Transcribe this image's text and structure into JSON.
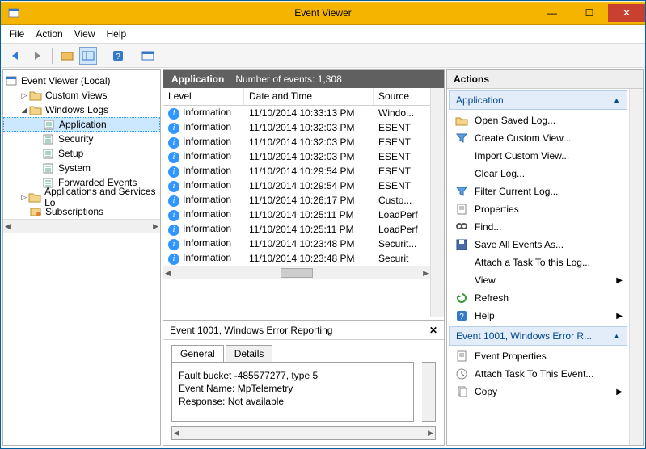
{
  "window": {
    "title": "Event Viewer"
  },
  "menu": [
    "File",
    "Action",
    "View",
    "Help"
  ],
  "nav": {
    "root": "Event Viewer (Local)",
    "items": [
      {
        "label": "Custom Views",
        "indent": 1,
        "tw": "▷",
        "icon": "folder"
      },
      {
        "label": "Windows Logs",
        "indent": 1,
        "tw": "◢",
        "icon": "folder"
      },
      {
        "label": "Application",
        "indent": 2,
        "sel": true,
        "icon": "log"
      },
      {
        "label": "Security",
        "indent": 2,
        "icon": "log"
      },
      {
        "label": "Setup",
        "indent": 2,
        "icon": "log"
      },
      {
        "label": "System",
        "indent": 2,
        "icon": "log"
      },
      {
        "label": "Forwarded Events",
        "indent": 2,
        "icon": "log"
      },
      {
        "label": "Applications and Services Lo",
        "indent": 1,
        "tw": "▷",
        "icon": "folder"
      },
      {
        "label": "Subscriptions",
        "indent": 1,
        "icon": "sub"
      }
    ]
  },
  "center": {
    "title": "Application",
    "count_label": "Number of events: 1,308",
    "cols": [
      "Level",
      "Date and Time",
      "Source"
    ],
    "rows": [
      {
        "level": "Information",
        "dt": "11/10/2014 10:33:13 PM",
        "src": "Windo..."
      },
      {
        "level": "Information",
        "dt": "11/10/2014 10:32:03 PM",
        "src": "ESENT"
      },
      {
        "level": "Information",
        "dt": "11/10/2014 10:32:03 PM",
        "src": "ESENT"
      },
      {
        "level": "Information",
        "dt": "11/10/2014 10:32:03 PM",
        "src": "ESENT"
      },
      {
        "level": "Information",
        "dt": "11/10/2014 10:29:54 PM",
        "src": "ESENT"
      },
      {
        "level": "Information",
        "dt": "11/10/2014 10:29:54 PM",
        "src": "ESENT"
      },
      {
        "level": "Information",
        "dt": "11/10/2014 10:26:17 PM",
        "src": "Custo..."
      },
      {
        "level": "Information",
        "dt": "11/10/2014 10:25:11 PM",
        "src": "LoadPerf"
      },
      {
        "level": "Information",
        "dt": "11/10/2014 10:25:11 PM",
        "src": "LoadPerf"
      },
      {
        "level": "Information",
        "dt": "11/10/2014 10:23:48 PM",
        "src": "Securit..."
      },
      {
        "level": "Information",
        "dt": "11/10/2014 10:23:48 PM",
        "src": "Securit"
      }
    ]
  },
  "detail": {
    "title": "Event 1001, Windows Error Reporting",
    "tabs": [
      "General",
      "Details"
    ],
    "lines": [
      "Fault bucket -485577277, type 5",
      "Event Name: MpTelemetry",
      "Response: Not available"
    ]
  },
  "actions": {
    "title": "Actions",
    "section1": "Application",
    "items1": [
      {
        "label": "Open Saved Log...",
        "icon": "open"
      },
      {
        "label": "Create Custom View...",
        "icon": "filter"
      },
      {
        "label": "Import Custom View...",
        "icon": ""
      },
      {
        "label": "Clear Log...",
        "icon": ""
      },
      {
        "label": "Filter Current Log...",
        "icon": "filter"
      },
      {
        "label": "Properties",
        "icon": "props"
      },
      {
        "label": "Find...",
        "icon": "find"
      },
      {
        "label": "Save All Events As...",
        "icon": "save"
      },
      {
        "label": "Attach a Task To this Log...",
        "icon": ""
      },
      {
        "label": "View",
        "icon": "",
        "sub": true
      },
      {
        "label": "Refresh",
        "icon": "refresh"
      },
      {
        "label": "Help",
        "icon": "help",
        "sub": true
      }
    ],
    "section2": "Event 1001, Windows Error R...",
    "items2": [
      {
        "label": "Event Properties",
        "icon": "props"
      },
      {
        "label": "Attach Task To This Event...",
        "icon": "task"
      },
      {
        "label": "Copy",
        "icon": "copy",
        "sub": true
      }
    ]
  }
}
